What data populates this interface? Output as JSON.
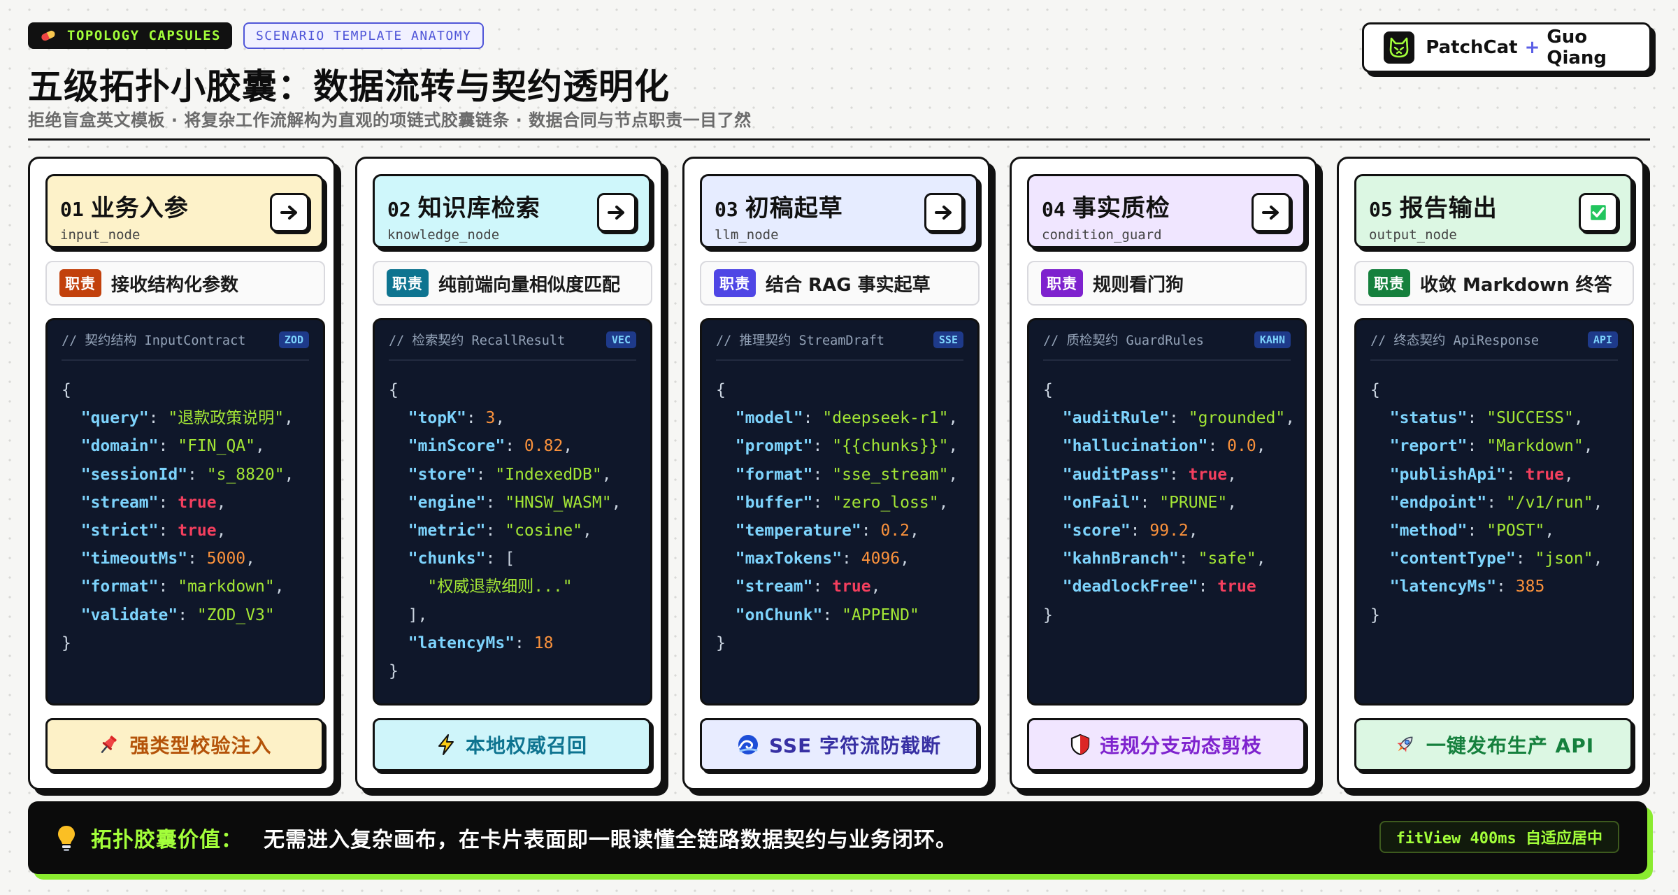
{
  "header": {
    "badge_primary": "TOPOLOGY CAPSULES",
    "badge_secondary": "SCENARIO TEMPLATE ANATOMY",
    "title": "五级拓扑小胶囊：数据流转与契约透明化",
    "subtitle": "拒绝盲盒英文模板 · 将复杂工作流解构为直观的项链式胶囊链条 · 数据合同与节点职责一目了然",
    "brand": {
      "name_a": "PatchCat",
      "plus": "+",
      "name_b": "Guo Qiang",
      "logo_icon": "cat-face-icon"
    }
  },
  "role_label": "职责",
  "cards": [
    {
      "num": "01",
      "name": "业务入参",
      "node_id": "input_node",
      "button_icon": "arrow-right-icon",
      "head_bg": "#fdf2c9",
      "role_color": "#c2410c",
      "role": "接收结构化参数",
      "code_comment": "// 契约结构 InputContract",
      "code_tag": "ZOD",
      "code_lines": [
        {
          "type": "brace",
          "text": "{"
        },
        {
          "type": "kv",
          "key": "query",
          "value": "退款政策说明",
          "vtype": "str"
        },
        {
          "type": "kv",
          "key": "domain",
          "value": "FIN_QA",
          "vtype": "str"
        },
        {
          "type": "kv",
          "key": "sessionId",
          "value": "s_8820",
          "vtype": "str"
        },
        {
          "type": "kv",
          "key": "stream",
          "value": "true",
          "vtype": "bool"
        },
        {
          "type": "kv",
          "key": "strict",
          "value": "true",
          "vtype": "bool"
        },
        {
          "type": "kv",
          "key": "timeoutMs",
          "value": "5000",
          "vtype": "num"
        },
        {
          "type": "kv",
          "key": "format",
          "value": "markdown",
          "vtype": "str"
        },
        {
          "type": "kv",
          "key": "validate",
          "value": "ZOD_V3",
          "vtype": "str",
          "last": true
        },
        {
          "type": "brace",
          "text": "}"
        }
      ],
      "action_icon": "pin-icon",
      "action": "强类型校验注入",
      "action_bg": "#fdf1c7",
      "action_color": "#b45309"
    },
    {
      "num": "02",
      "name": "知识库检索",
      "node_id": "knowledge_node",
      "button_icon": "arrow-right-icon",
      "head_bg": "#cff7fb",
      "role_color": "#0e7490",
      "role": "纯前端向量相似度匹配",
      "code_comment": "// 检索契约 RecallResult",
      "code_tag": "VEC",
      "code_lines": [
        {
          "type": "brace",
          "text": "{"
        },
        {
          "type": "kv",
          "key": "topK",
          "value": "3",
          "vtype": "num"
        },
        {
          "type": "kv",
          "key": "minScore",
          "value": "0.82",
          "vtype": "num"
        },
        {
          "type": "kv",
          "key": "store",
          "value": "IndexedDB",
          "vtype": "str"
        },
        {
          "type": "kv",
          "key": "engine",
          "value": "HNSW_WASM",
          "vtype": "str"
        },
        {
          "type": "kv",
          "key": "metric",
          "value": "cosine",
          "vtype": "str"
        },
        {
          "type": "kvopen",
          "key": "chunks",
          "open": "["
        },
        {
          "type": "item",
          "value": "权威退款细则..."
        },
        {
          "type": "close",
          "text": "],"
        },
        {
          "type": "kv",
          "key": "latencyMs",
          "value": "18",
          "vtype": "num",
          "last": true
        },
        {
          "type": "brace",
          "text": "}"
        }
      ],
      "action_icon": "lightning-icon",
      "action": "本地权威召回",
      "action_bg": "#cff5fa",
      "action_color": "#0e7490"
    },
    {
      "num": "03",
      "name": "初稿起草",
      "node_id": "llm_node",
      "button_icon": "arrow-right-icon",
      "head_bg": "#e6ecff",
      "role_color": "#4f46e5",
      "role": "结合 RAG 事实起草",
      "code_comment": "// 推理契约 StreamDraft",
      "code_tag": "SSE",
      "code_lines": [
        {
          "type": "brace",
          "text": "{"
        },
        {
          "type": "kv",
          "key": "model",
          "value": "deepseek-r1",
          "vtype": "str"
        },
        {
          "type": "kv",
          "key": "prompt",
          "value": "{{chunks}}",
          "vtype": "str"
        },
        {
          "type": "kv",
          "key": "format",
          "value": "sse_stream",
          "vtype": "str"
        },
        {
          "type": "kv",
          "key": "buffer",
          "value": "zero_loss",
          "vtype": "str"
        },
        {
          "type": "kv",
          "key": "temperature",
          "value": "0.2",
          "vtype": "num"
        },
        {
          "type": "kv",
          "key": "maxTokens",
          "value": "4096",
          "vtype": "num"
        },
        {
          "type": "kv",
          "key": "stream",
          "value": "true",
          "vtype": "bool"
        },
        {
          "type": "kv",
          "key": "onChunk",
          "value": "APPEND",
          "vtype": "str",
          "last": true
        },
        {
          "type": "brace",
          "text": "}"
        }
      ],
      "action_icon": "wave-icon",
      "action": "SSE 字符流防截断",
      "action_bg": "#e8ecff",
      "action_color": "#3730a3"
    },
    {
      "num": "04",
      "name": "事实质检",
      "node_id": "condition_guard",
      "button_icon": "arrow-right-icon",
      "head_bg": "#f0e6ff",
      "role_color": "#7e22ce",
      "role": "规则看门狗",
      "code_comment": "// 质检契约 GuardRules",
      "code_tag": "KAHN",
      "code_lines": [
        {
          "type": "brace",
          "text": "{"
        },
        {
          "type": "kv",
          "key": "auditRule",
          "value": "grounded",
          "vtype": "str"
        },
        {
          "type": "kv",
          "key": "hallucination",
          "value": "0.0",
          "vtype": "num"
        },
        {
          "type": "kv",
          "key": "auditPass",
          "value": "true",
          "vtype": "bool"
        },
        {
          "type": "kv",
          "key": "onFail",
          "value": "PRUNE",
          "vtype": "str"
        },
        {
          "type": "kv",
          "key": "score",
          "value": "99.2",
          "vtype": "num"
        },
        {
          "type": "kv",
          "key": "kahnBranch",
          "value": "safe",
          "vtype": "str"
        },
        {
          "type": "kv",
          "key": "deadlockFree",
          "value": "true",
          "vtype": "bool",
          "last": true
        },
        {
          "type": "brace",
          "text": "}"
        }
      ],
      "action_icon": "shield-icon",
      "action": "违规分支动态剪枝",
      "action_bg": "#f1e6ff",
      "action_color": "#7e22ce"
    },
    {
      "num": "05",
      "name": "报告输出",
      "node_id": "output_node",
      "button_icon": "check-box-icon",
      "head_bg": "#dcf7e3",
      "role_color": "#15803d",
      "role": "收敛 Markdown 终答",
      "code_comment": "// 终态契约 ApiResponse",
      "code_tag": "API",
      "code_lines": [
        {
          "type": "brace",
          "text": "{"
        },
        {
          "type": "kv",
          "key": "status",
          "value": "SUCCESS",
          "vtype": "str"
        },
        {
          "type": "kv",
          "key": "report",
          "value": "Markdown",
          "vtype": "str"
        },
        {
          "type": "kv",
          "key": "publishApi",
          "value": "true",
          "vtype": "bool"
        },
        {
          "type": "kv",
          "key": "endpoint",
          "value": "/v1/run",
          "vtype": "str"
        },
        {
          "type": "kv",
          "key": "method",
          "value": "POST",
          "vtype": "str"
        },
        {
          "type": "kv",
          "key": "contentType",
          "value": "json",
          "vtype": "str"
        },
        {
          "type": "kv",
          "key": "latencyMs",
          "value": "385",
          "vtype": "num",
          "last": true
        },
        {
          "type": "brace",
          "text": "}"
        }
      ],
      "action_icon": "rocket-icon",
      "action": "一键发布生产 API",
      "action_bg": "#dcf7e3",
      "action_color": "#15803d"
    }
  ],
  "footer": {
    "icon": "lightbulb-icon",
    "label": "拓扑胶囊价值：",
    "text": "无需进入复杂画布，在卡片表面即一眼读懂全链路数据契约与业务闭环。",
    "badge": "fitView 400ms 自适应居中"
  },
  "colors": {
    "accent_green": "#a3ff3a",
    "ink": "#111111",
    "accent_indigo": "#4f55d8"
  }
}
